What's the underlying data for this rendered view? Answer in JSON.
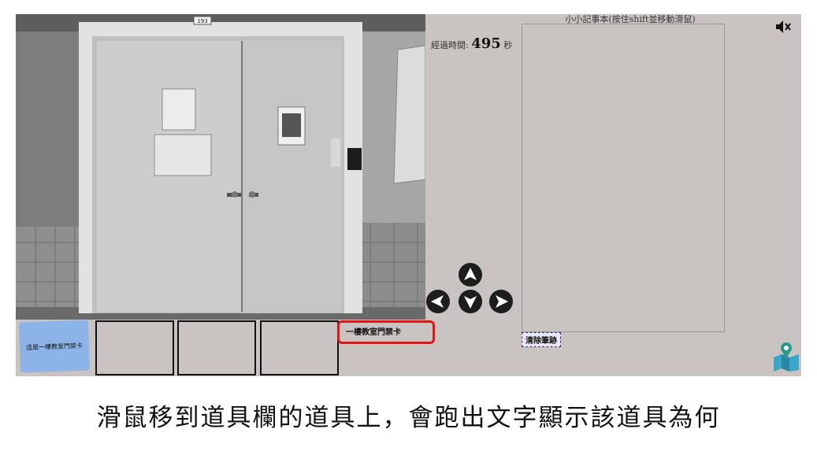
{
  "game": {
    "timer_label": "經過時間:",
    "timer_value": "495",
    "timer_unit": "秒",
    "notebook_title": "小小記事本(按住shift並移動滑鼠)",
    "clear_button": "清除筆跡",
    "scene": {
      "door_sign": "193"
    },
    "nav_arrows": [
      "up-arrow",
      "left-arrow",
      "down-arrow",
      "right-arrow"
    ],
    "inventory": {
      "slot1_item_text": "這是一樓教室門禁卡",
      "slot_count": 4
    },
    "tooltip_text": "一樓教室門禁卡",
    "icons": {
      "mute": "speaker-muted-icon",
      "map": "map-pin-icon"
    }
  },
  "caption": "滑鼠移到道具欄的道具上，會跑出文字顯示該道具為何",
  "colors": {
    "panel_bg": "#c9c4c2",
    "highlight": "#e01616",
    "card_bg": "#8cb4e8"
  }
}
